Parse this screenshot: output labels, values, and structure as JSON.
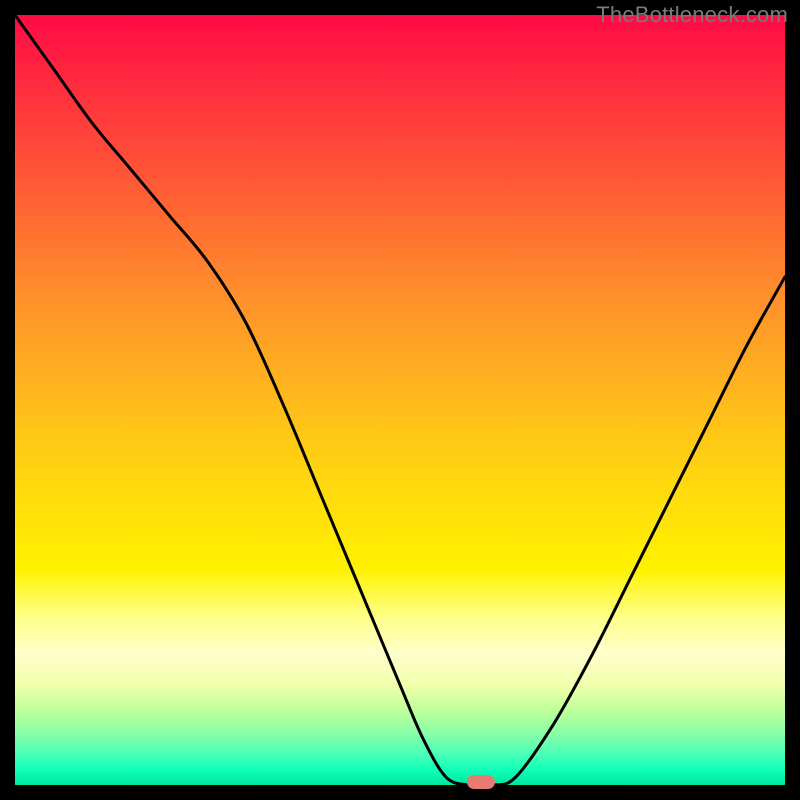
{
  "watermark": "TheBottleneck.com",
  "colors": {
    "curve_stroke": "#000000",
    "marker_fill": "#e77b72",
    "frame_bg": "#000000"
  },
  "chart_data": {
    "type": "line",
    "title": "",
    "xlabel": "",
    "ylabel": "",
    "xlim": [
      0,
      100
    ],
    "ylim": [
      0,
      100
    ],
    "series": [
      {
        "name": "bottleneck-curve",
        "x": [
          0,
          5,
          10,
          15,
          20,
          25,
          30,
          35,
          40,
          45,
          50,
          53,
          56,
          59,
          62,
          65,
          70,
          75,
          80,
          85,
          90,
          95,
          100
        ],
        "values": [
          100,
          93,
          86,
          80,
          74,
          68,
          60,
          49,
          37,
          25,
          13,
          6,
          1,
          0,
          0,
          1,
          8,
          17,
          27,
          37,
          47,
          57,
          66
        ]
      }
    ],
    "marker": {
      "x": 60.5,
      "y": 0
    },
    "gradient_stops": [
      {
        "pos": 0,
        "color": "#ff0a46"
      },
      {
        "pos": 10,
        "color": "#ff2f3e"
      },
      {
        "pos": 22,
        "color": "#ff5a36"
      },
      {
        "pos": 35,
        "color": "#ff8a2c"
      },
      {
        "pos": 48,
        "color": "#ffb41f"
      },
      {
        "pos": 60,
        "color": "#ffd60f"
      },
      {
        "pos": 72,
        "color": "#fff200"
      },
      {
        "pos": 78,
        "color": "#ffff86"
      },
      {
        "pos": 83,
        "color": "#ffffcc"
      },
      {
        "pos": 87,
        "color": "#f0ffab"
      },
      {
        "pos": 90,
        "color": "#c3ff9a"
      },
      {
        "pos": 93,
        "color": "#8fffa5"
      },
      {
        "pos": 96,
        "color": "#4affb6"
      },
      {
        "pos": 98,
        "color": "#10ffb7"
      },
      {
        "pos": 100,
        "color": "#00e6a0"
      }
    ]
  }
}
